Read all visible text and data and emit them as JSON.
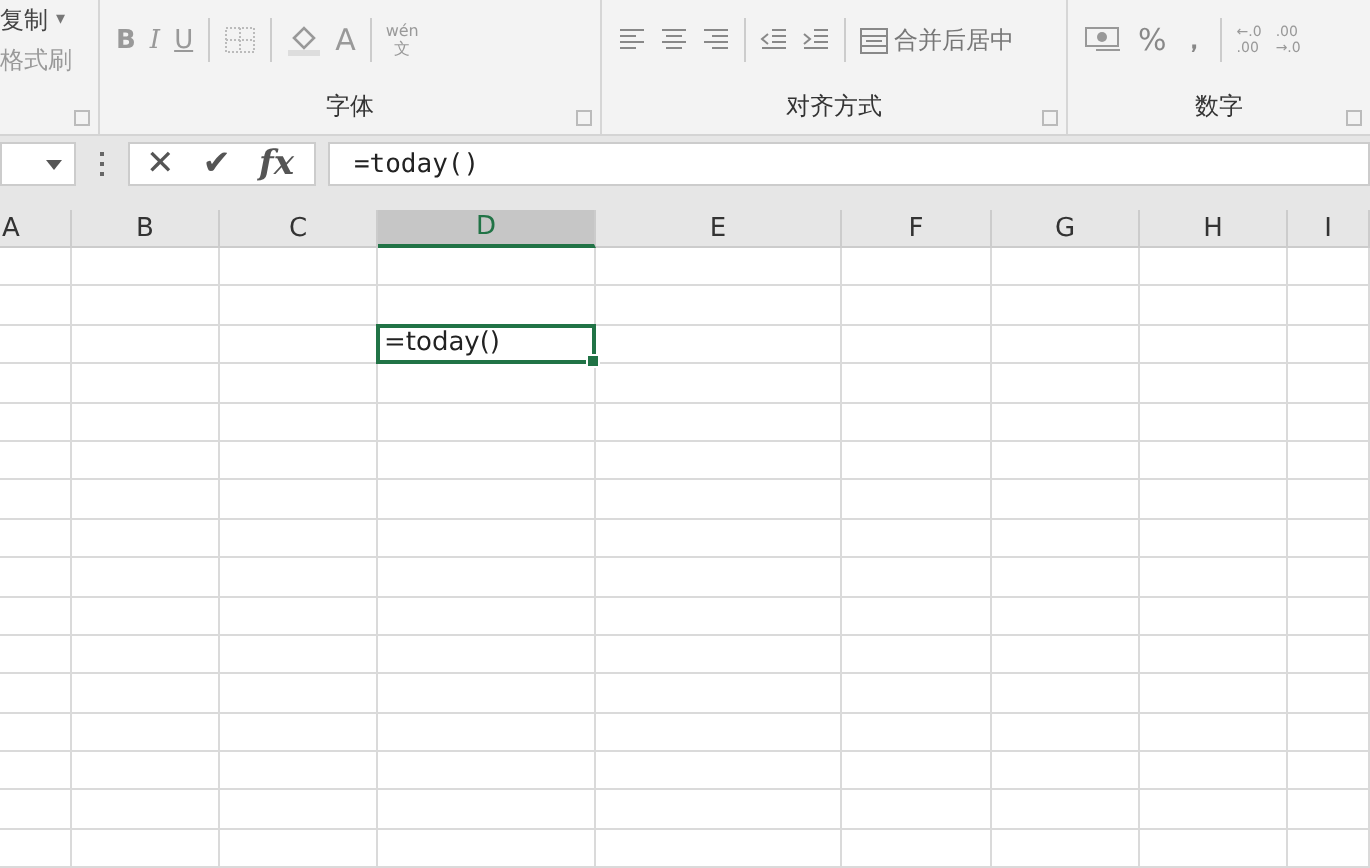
{
  "ribbon": {
    "clipboard": {
      "items": [
        "复制",
        "格式刷"
      ],
      "caret": "▾"
    },
    "font": {
      "label": "字体",
      "bold": "B",
      "italic": "I",
      "underline": "U",
      "font_color": "A",
      "phonetic_top": "wén",
      "phonetic_bottom": "文"
    },
    "alignment": {
      "label": "对齐方式",
      "merge": "合并后居中"
    },
    "number": {
      "label": "数字",
      "percent": "%",
      "comma": "，",
      "increase_decimal_top": "←.0",
      "increase_decimal_bottom": ".00",
      "decrease_decimal_top": ".00",
      "decrease_decimal_bottom": "→.0"
    }
  },
  "formula_bar": {
    "cancel": "✕",
    "confirm": "✔",
    "function": "fx",
    "formula": "=today()"
  },
  "columns": [
    {
      "label": "A",
      "selected": false
    },
    {
      "label": "B",
      "selected": false
    },
    {
      "label": "C",
      "selected": false
    },
    {
      "label": "D",
      "selected": true
    },
    {
      "label": "E",
      "selected": false
    },
    {
      "label": "F",
      "selected": false
    },
    {
      "label": "G",
      "selected": false
    },
    {
      "label": "H",
      "selected": false
    },
    {
      "label": "I",
      "selected": false
    }
  ],
  "active_cell": {
    "value": "=today()"
  }
}
